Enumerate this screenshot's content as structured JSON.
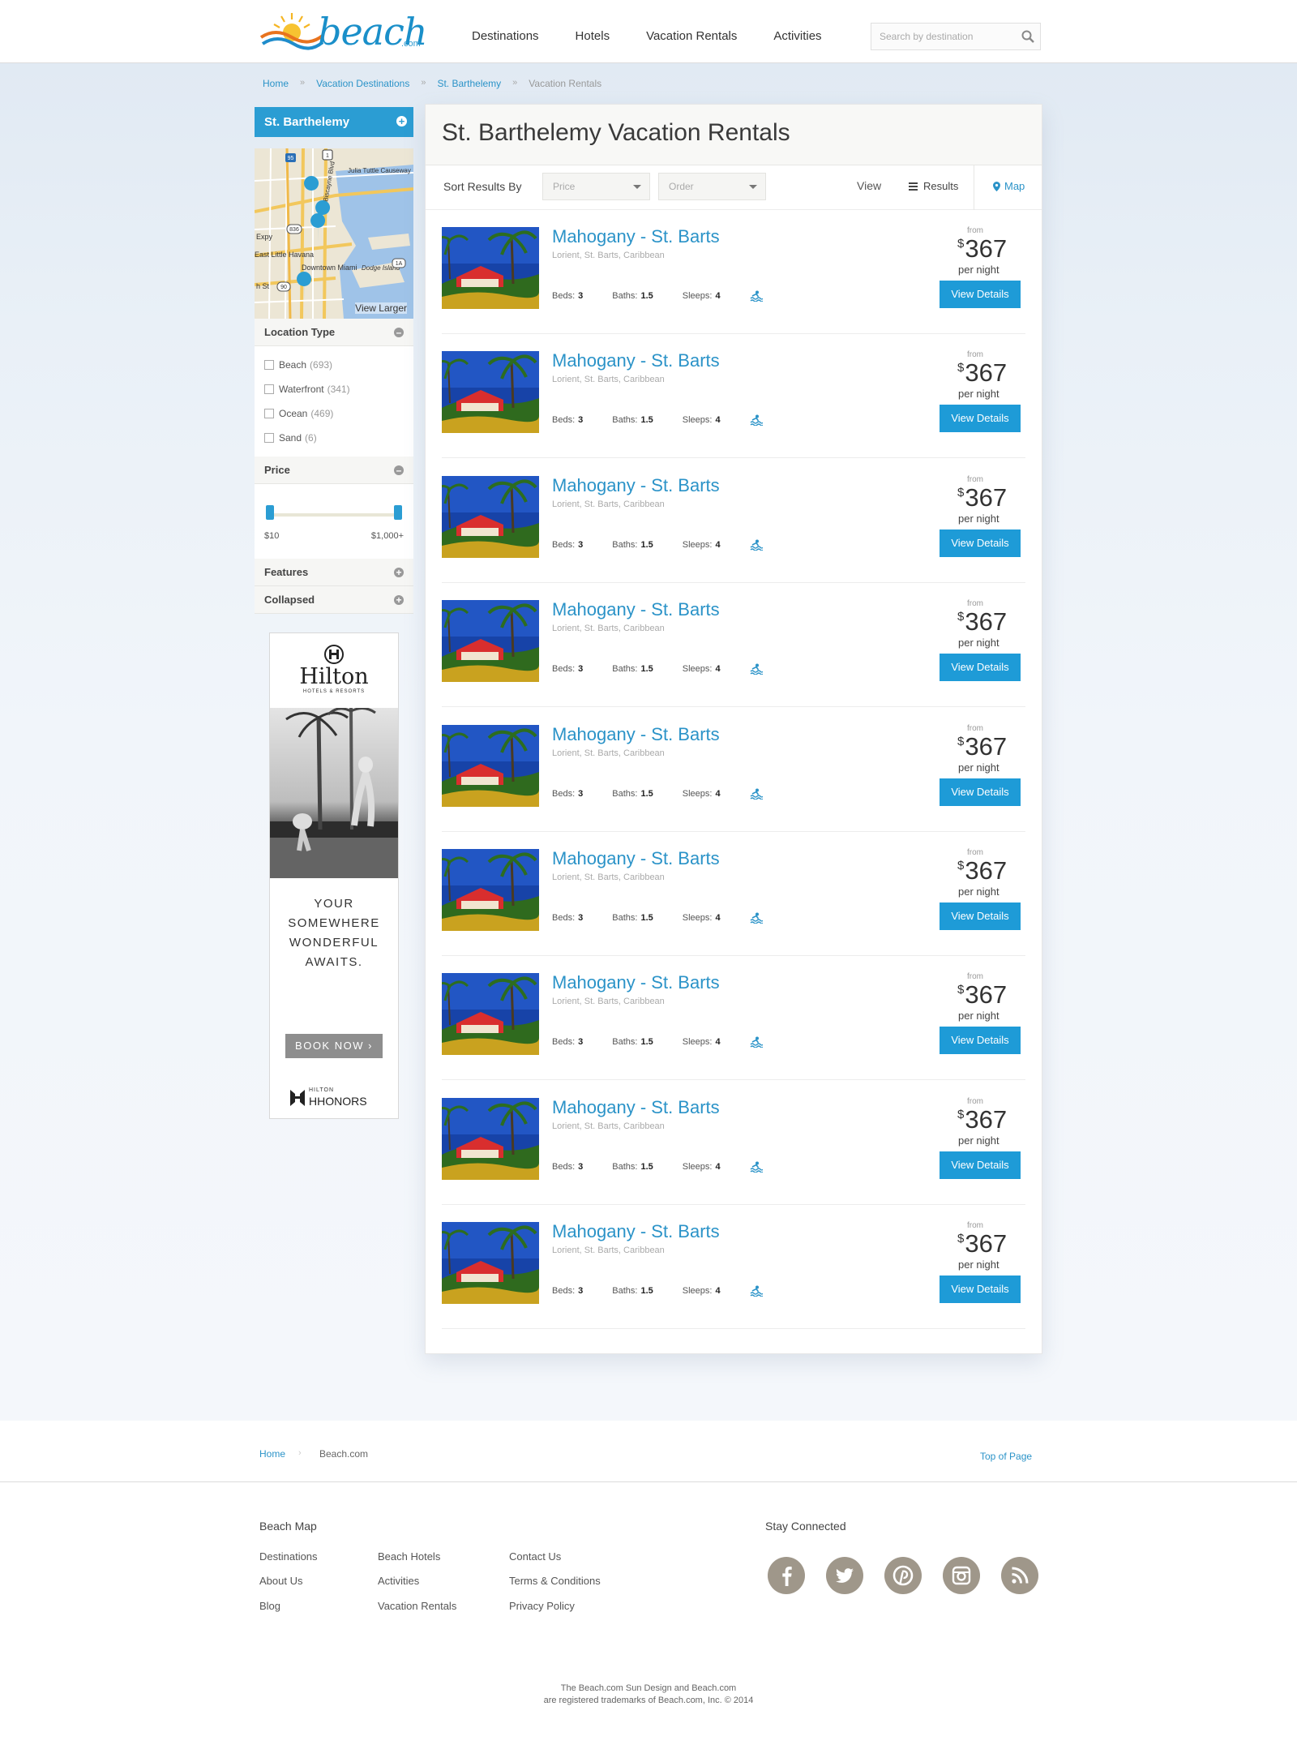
{
  "header": {
    "logo_text": "beach",
    "logo_suffix": ".com",
    "nav": [
      "Destinations",
      "Hotels",
      "Vacation Rentals",
      "Activities"
    ],
    "search_placeholder": "Search by destination"
  },
  "breadcrumb": [
    "Home",
    "Vacation Destinations",
    "St. Barthelemy",
    "Vacation Rentals"
  ],
  "sidebar": {
    "destination": "St. Barthelemy",
    "map": {
      "view_larger": "View Larger",
      "labels": [
        "Julia Tuttle Causeway",
        "Biscayne Blvd",
        "East Little Havana",
        "Downtown Miami",
        "Dodge Island",
        "Expy",
        "h St",
        "95",
        "836",
        "90",
        "1A",
        "1"
      ]
    },
    "location_type": {
      "title": "Location Type",
      "items": [
        {
          "label": "Beach",
          "count": "(693)"
        },
        {
          "label": "Waterfront",
          "count": "(341)"
        },
        {
          "label": "Ocean",
          "count": "(469)"
        },
        {
          "label": "Sand",
          "count": "(6)"
        }
      ]
    },
    "price": {
      "title": "Price",
      "min": "$10",
      "max": "$1,000+",
      "range_fraction": [
        0,
        1
      ]
    },
    "features": "Features",
    "collapsed": "Collapsed"
  },
  "ad": {
    "brand": "Hilton",
    "brand_sub": "HOTELS & RESORTS",
    "tagline": [
      "YOUR",
      "SOMEWHERE",
      "WONDERFUL",
      "AWAITS."
    ],
    "button": "BOOK NOW",
    "program_top": "HILTON",
    "program": "HHONORS"
  },
  "main": {
    "title": "St. Barthelemy Vacation Rentals",
    "sort_label": "Sort Results By",
    "sort_price": "Price",
    "sort_order": "Order",
    "view_label": "View",
    "view_results": "Results",
    "view_map": "Map",
    "listings": [
      {
        "title": "Mahogany - St. Barts",
        "location": "Lorient, St. Barts, Caribbean",
        "beds_label": "Beds:",
        "beds": "3",
        "baths_label": "Baths:",
        "baths": "1.5",
        "sleeps_label": "Sleeps:",
        "sleeps": "4",
        "from": "from",
        "currency": "$",
        "price": "367",
        "per": "per night",
        "button": "View Details"
      },
      {
        "title": "Mahogany - St. Barts",
        "location": "Lorient, St. Barts, Caribbean",
        "beds_label": "Beds:",
        "beds": "3",
        "baths_label": "Baths:",
        "baths": "1.5",
        "sleeps_label": "Sleeps:",
        "sleeps": "4",
        "from": "from",
        "currency": "$",
        "price": "367",
        "per": "per night",
        "button": "View Details"
      },
      {
        "title": "Mahogany - St. Barts",
        "location": "Lorient, St. Barts, Caribbean",
        "beds_label": "Beds:",
        "beds": "3",
        "baths_label": "Baths:",
        "baths": "1.5",
        "sleeps_label": "Sleeps:",
        "sleeps": "4",
        "from": "from",
        "currency": "$",
        "price": "367",
        "per": "per night",
        "button": "View Details"
      },
      {
        "title": "Mahogany - St. Barts",
        "location": "Lorient, St. Barts, Caribbean",
        "beds_label": "Beds:",
        "beds": "3",
        "baths_label": "Baths:",
        "baths": "1.5",
        "sleeps_label": "Sleeps:",
        "sleeps": "4",
        "from": "from",
        "currency": "$",
        "price": "367",
        "per": "per night",
        "button": "View Details"
      },
      {
        "title": "Mahogany - St. Barts",
        "location": "Lorient, St. Barts, Caribbean",
        "beds_label": "Beds:",
        "beds": "3",
        "baths_label": "Baths:",
        "baths": "1.5",
        "sleeps_label": "Sleeps:",
        "sleeps": "4",
        "from": "from",
        "currency": "$",
        "price": "367",
        "per": "per night",
        "button": "View Details"
      },
      {
        "title": "Mahogany - St. Barts",
        "location": "Lorient, St. Barts, Caribbean",
        "beds_label": "Beds:",
        "beds": "3",
        "baths_label": "Baths:",
        "baths": "1.5",
        "sleeps_label": "Sleeps:",
        "sleeps": "4",
        "from": "from",
        "currency": "$",
        "price": "367",
        "per": "per night",
        "button": "View Details"
      },
      {
        "title": "Mahogany - St. Barts",
        "location": "Lorient, St. Barts, Caribbean",
        "beds_label": "Beds:",
        "beds": "3",
        "baths_label": "Baths:",
        "baths": "1.5",
        "sleeps_label": "Sleeps:",
        "sleeps": "4",
        "from": "from",
        "currency": "$",
        "price": "367",
        "per": "per night",
        "button": "View Details"
      },
      {
        "title": "Mahogany - St. Barts",
        "location": "Lorient, St. Barts, Caribbean",
        "beds_label": "Beds:",
        "beds": "3",
        "baths_label": "Baths:",
        "baths": "1.5",
        "sleeps_label": "Sleeps:",
        "sleeps": "4",
        "from": "from",
        "currency": "$",
        "price": "367",
        "per": "per night",
        "button": "View Details"
      },
      {
        "title": "Mahogany - St. Barts",
        "location": "Lorient, St. Barts, Caribbean",
        "beds_label": "Beds:",
        "beds": "3",
        "baths_label": "Baths:",
        "baths": "1.5",
        "sleeps_label": "Sleeps:",
        "sleeps": "4",
        "from": "from",
        "currency": "$",
        "price": "367",
        "per": "per night",
        "button": "View Details"
      }
    ]
  },
  "footer": {
    "breadcrumb_home": "Home",
    "breadcrumb_sep": "›",
    "breadcrumb_site": "Beach.com",
    "top_of_page": "Top of Page",
    "map_title": "Beach Map",
    "links_col1": [
      "Destinations",
      "About Us",
      "Blog"
    ],
    "links_col2": [
      "Beach Hotels",
      "Activities",
      "Vacation Rentals"
    ],
    "links_col3": [
      "Contact Us",
      "Terms & Conditions",
      "Privacy Policy"
    ],
    "connect_title": "Stay Connected",
    "social": [
      "facebook-icon",
      "twitter-icon",
      "pinterest-icon",
      "instagram-icon",
      "rss-icon"
    ],
    "copyright_1": "The Beach.com Sun Design and Beach.com",
    "copyright_2": "are registered trademarks of Beach.com, Inc. © 2014"
  },
  "colors": {
    "accent": "#1e9bd7",
    "link": "#2b93c8",
    "social": "#9f978a"
  }
}
